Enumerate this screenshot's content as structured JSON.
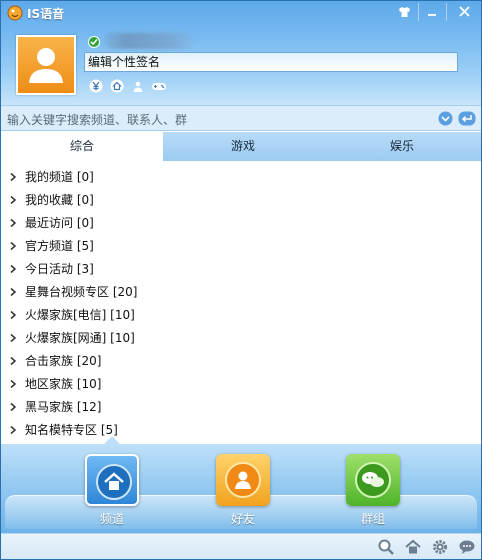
{
  "app": {
    "title": "IS语音"
  },
  "profile": {
    "signature_placeholder": "编辑个性签名",
    "quick_icons": [
      "yen-icon",
      "home-icon",
      "upload-icon",
      "gamepad-icon"
    ]
  },
  "search": {
    "placeholder": "输入关键字搜索频道、联系人、群"
  },
  "tabs": [
    {
      "label": "综合",
      "active": true
    },
    {
      "label": "游戏",
      "active": false
    },
    {
      "label": "娱乐",
      "active": false
    }
  ],
  "categories": [
    {
      "label": "我的频道  [0]"
    },
    {
      "label": "我的收藏  [0]"
    },
    {
      "label": "最近访问  [0]"
    },
    {
      "label": "官方频道  [5]"
    },
    {
      "label": "今日活动  [3]"
    },
    {
      "label": "星舞台视频专区  [20]"
    },
    {
      "label": "火爆家族[电信]  [10]"
    },
    {
      "label": "火爆家族[网通]  [10]"
    },
    {
      "label": "合击家族  [20]"
    },
    {
      "label": "地区家族  [10]"
    },
    {
      "label": "黑马家族  [12]"
    },
    {
      "label": "知名模特专区  [5]"
    }
  ],
  "dock": [
    {
      "label": "频道",
      "icon": "home-icon",
      "color": "#2f86d6",
      "active": true
    },
    {
      "label": "好友",
      "icon": "user-icon",
      "color": "#f0a21e",
      "active": false
    },
    {
      "label": "群组",
      "icon": "chat-icon",
      "color": "#4fb32a",
      "active": false
    }
  ],
  "status_icons": [
    "search-icon",
    "home-icon",
    "gear-icon",
    "chat-icon"
  ],
  "colors": {
    "header": "#5ea9ea",
    "accent": "#2a6fb0",
    "tab_bar": "#b7dbf7"
  }
}
